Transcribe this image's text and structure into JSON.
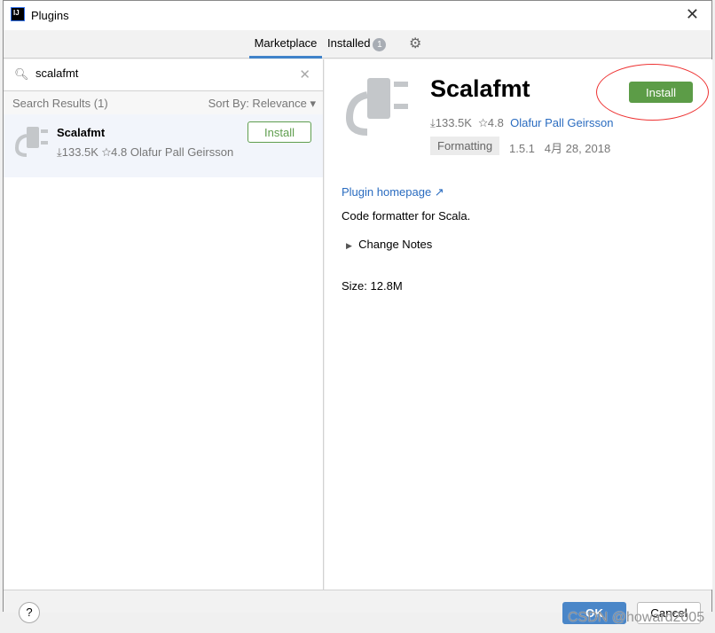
{
  "window": {
    "title": "Plugins",
    "close": "✕",
    "logo": "IJ"
  },
  "tabs": [
    {
      "label": "Marketplace",
      "active": true
    },
    {
      "label": "Installed",
      "badge": "1"
    }
  ],
  "search": {
    "value": "scalafmt",
    "placeholder": ""
  },
  "results": {
    "header": "Search Results (1)",
    "sort": "Sort By: Relevance ▾",
    "items": [
      {
        "name": "Scalafmt",
        "downloads": "⤓133.5K",
        "rating": "☆4.8",
        "author": "Olafur Pall Geirsson",
        "button": "Install"
      }
    ]
  },
  "detail": {
    "name": "Scalafmt",
    "button": "Install",
    "downloads": "⤓133.5K",
    "rating": "☆4.8",
    "author": "Olafur Pall Geirsson",
    "tag": "Formatting",
    "version": "1.5.1",
    "date": "4月 28, 2018",
    "homepage": "Plugin homepage ↗",
    "description": "Code formatter for Scala.",
    "change_notes": "Change Notes",
    "size": "Size: 12.8M"
  },
  "footer": {
    "help": "?",
    "ok": "OK",
    "cancel": "Cancel"
  },
  "watermark": "CSDN @howard2005",
  "colors": {
    "accent": "#4083c9",
    "install": "#5c9c47",
    "link": "#2a6cc0"
  }
}
